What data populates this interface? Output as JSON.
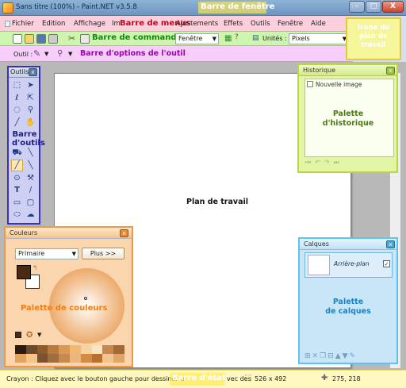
{
  "window": {
    "title": "Sans titre (100%) - Paint.NET v3.5.8",
    "buttons": {
      "minimize": "–",
      "maximize": "□",
      "close": "X"
    }
  },
  "annotations": {
    "title_bar": "Barre de fenêtre",
    "menu_bar": "Barre de menus",
    "command_bar": "Barre de commandes",
    "tool_options_bar": "Barre d'options de l'outil",
    "tools_bar": [
      "Barre",
      "d'outils"
    ],
    "workspace": "Plan de travail",
    "history_palette": [
      "Palette",
      "d'historique"
    ],
    "colors_palette": "Palette de couleurs",
    "layers_palette": [
      "Palette",
      "de calques"
    ],
    "status_bar": "Barre d'état",
    "workspace_icon": [
      "Icone du",
      "plan de",
      "travail"
    ]
  },
  "menu": {
    "items": [
      "Fichier",
      "Edition",
      "Affichage",
      "Im",
      "Ajustements",
      "Effets",
      "Outils",
      "Fenêtre",
      "Aide"
    ]
  },
  "command_bar": {
    "window_combo": "Fenêtre",
    "units_label": "Unités :",
    "units_combo": "Pixels"
  },
  "tool_options": {
    "tool_label": "Outil :"
  },
  "tools_panel": {
    "title": "Outils",
    "tools": [
      "select-rect",
      "move-selection",
      "lasso",
      "move-selected",
      "ellipse-select",
      "zoom",
      "magic-wand",
      "pan",
      "paint-bucket",
      "gradient",
      "pencil",
      "paintbrush",
      "eraser",
      "color-picker",
      "clone-stamp",
      "recolor",
      "text",
      "line-curve",
      "rectangle",
      "rounded-rect",
      "ellipse",
      "freeform-shape"
    ]
  },
  "history_panel": {
    "title": "Historique",
    "items": [
      "Nouvelle image"
    ]
  },
  "colors_panel": {
    "title": "Couleurs",
    "mode": "Primaire",
    "more_button": "Plus >>",
    "primary_color": "#4a2a12",
    "secondary_color": "#ffffff",
    "palette": [
      "#2b1a0d",
      "#6b4a2a",
      "#8e5b2b",
      "#b77b3d",
      "#d99a54",
      "#f0b973",
      "#f6d3a0",
      "#fbe4c4",
      "#c6894b",
      "#a46a33",
      "#e2a35d",
      "#f4c48a",
      "#7a5230",
      "#9f6d3e",
      "#c7894e",
      "#ebb57e",
      "#d38b45",
      "#b96f2d",
      "#f2c590",
      "#e0a566"
    ]
  },
  "layers_panel": {
    "title": "Calques",
    "layers": [
      {
        "name": "Arrière-plan",
        "visible": true
      }
    ]
  },
  "status": {
    "hint": "Crayon : Cliquez avec le bouton gauche pour dessiner u",
    "hint_tail": "vec des",
    "image_size": "526 x 492",
    "cursor_pos": "275, 218"
  }
}
